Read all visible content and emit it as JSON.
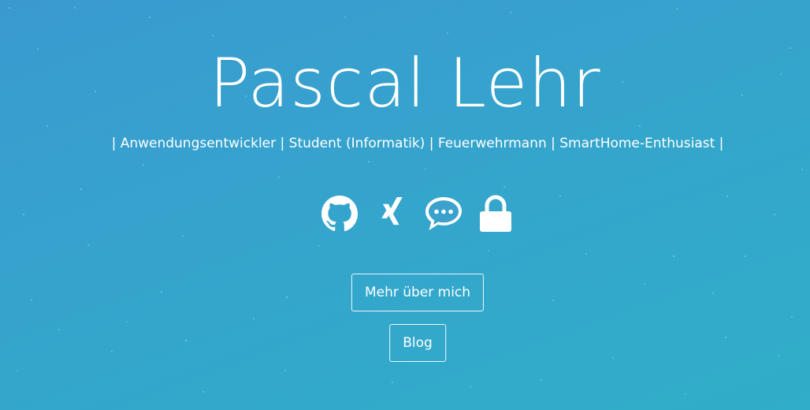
{
  "hero": {
    "name": "Pascal Lehr",
    "tagline": "| Anwendungsentwickler | Student (Informatik) | Feuerwehrmann | SmartHome-Enthusiast |"
  },
  "socials": [
    {
      "icon": "github-icon"
    },
    {
      "icon": "xing-icon"
    },
    {
      "icon": "chat-icon"
    },
    {
      "icon": "lock-icon"
    }
  ],
  "buttons": {
    "about_label": "Mehr über mich",
    "blog_label": "Blog"
  },
  "colors": {
    "background_start": "#3a9ad0",
    "background_end": "#30adc8",
    "foreground": "#ffffff"
  }
}
